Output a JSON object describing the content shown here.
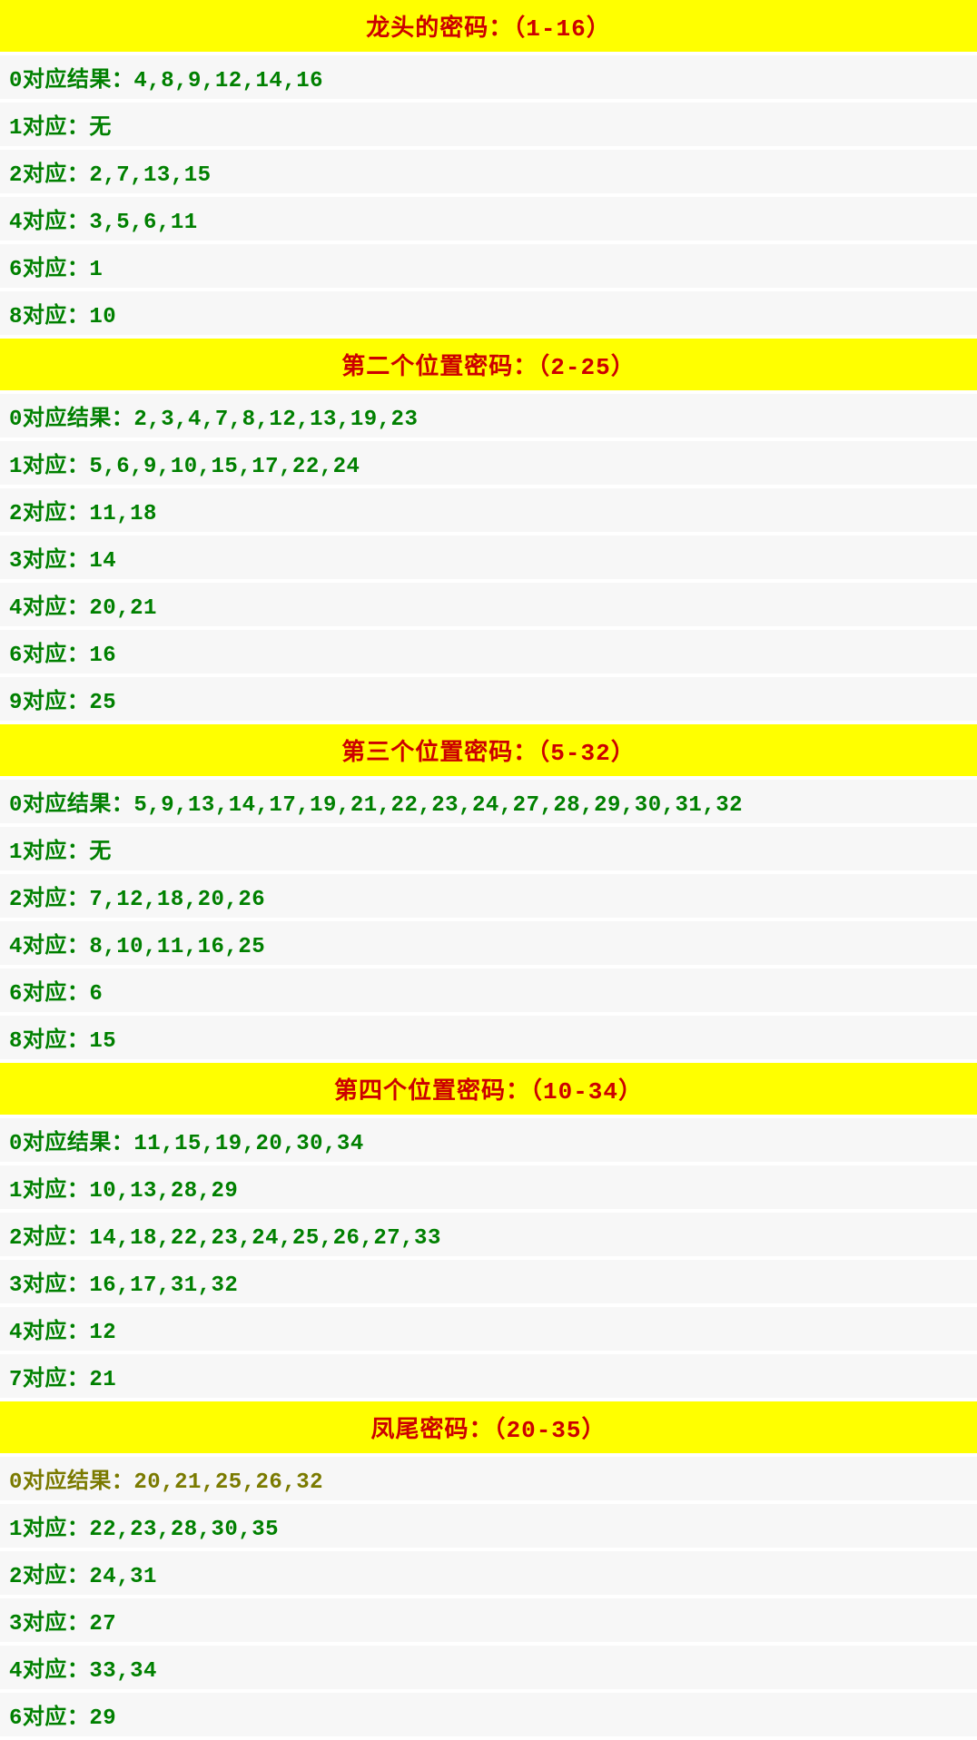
{
  "sections": [
    {
      "title": "龙头的密码：（1-16）",
      "rows": [
        {
          "text": "0对应结果：4,8,9,12,14,16",
          "olive": false
        },
        {
          "text": "1对应：无",
          "olive": false
        },
        {
          "text": "2对应：2,7,13,15",
          "olive": false
        },
        {
          "text": "4对应：3,5,6,11",
          "olive": false
        },
        {
          "text": "6对应：1",
          "olive": false
        },
        {
          "text": "8对应：10",
          "olive": false
        }
      ]
    },
    {
      "title": "第二个位置密码：（2-25）",
      "rows": [
        {
          "text": "0对应结果：2,3,4,7,8,12,13,19,23",
          "olive": false
        },
        {
          "text": "1对应：5,6,9,10,15,17,22,24",
          "olive": false
        },
        {
          "text": "2对应：11,18",
          "olive": false
        },
        {
          "text": "3对应：14",
          "olive": false
        },
        {
          "text": "4对应：20,21",
          "olive": false
        },
        {
          "text": "6对应：16",
          "olive": false
        },
        {
          "text": "9对应：25",
          "olive": false
        }
      ]
    },
    {
      "title": "第三个位置密码：（5-32）",
      "rows": [
        {
          "text": "0对应结果：5,9,13,14,17,19,21,22,23,24,27,28,29,30,31,32",
          "olive": false
        },
        {
          "text": "1对应：无",
          "olive": false
        },
        {
          "text": "2对应：7,12,18,20,26",
          "olive": false
        },
        {
          "text": "4对应：8,10,11,16,25",
          "olive": false
        },
        {
          "text": "6对应：6",
          "olive": false
        },
        {
          "text": "8对应：15",
          "olive": false
        }
      ]
    },
    {
      "title": "第四个位置密码：（10-34）",
      "rows": [
        {
          "text": "0对应结果：11,15,19,20,30,34",
          "olive": false
        },
        {
          "text": "1对应：10,13,28,29",
          "olive": false
        },
        {
          "text": "2对应：14,18,22,23,24,25,26,27,33",
          "olive": false
        },
        {
          "text": "3对应：16,17,31,32",
          "olive": false
        },
        {
          "text": "4对应：12",
          "olive": false
        },
        {
          "text": "7对应：21",
          "olive": false
        }
      ]
    },
    {
      "title": "凤尾密码：（20-35）",
      "rows": [
        {
          "text": "0对应结果：20,21,25,26,32",
          "olive": true
        },
        {
          "text": "1对应：22,23,28,30,35",
          "olive": false
        },
        {
          "text": "2对应：24,31",
          "olive": false
        },
        {
          "text": "3对应：27",
          "olive": false
        },
        {
          "text": "4对应：33,34",
          "olive": false
        },
        {
          "text": "6对应：29",
          "olive": false
        }
      ]
    }
  ],
  "chart_data": {
    "type": "table",
    "title": "位置密码对照表",
    "sections": [
      {
        "name": "龙头的密码",
        "range": "1-16",
        "mappings": [
          {
            "key": 0,
            "values": [
              4,
              8,
              9,
              12,
              14,
              16
            ]
          },
          {
            "key": 1,
            "values": []
          },
          {
            "key": 2,
            "values": [
              2,
              7,
              13,
              15
            ]
          },
          {
            "key": 4,
            "values": [
              3,
              5,
              6,
              11
            ]
          },
          {
            "key": 6,
            "values": [
              1
            ]
          },
          {
            "key": 8,
            "values": [
              10
            ]
          }
        ]
      },
      {
        "name": "第二个位置密码",
        "range": "2-25",
        "mappings": [
          {
            "key": 0,
            "values": [
              2,
              3,
              4,
              7,
              8,
              12,
              13,
              19,
              23
            ]
          },
          {
            "key": 1,
            "values": [
              5,
              6,
              9,
              10,
              15,
              17,
              22,
              24
            ]
          },
          {
            "key": 2,
            "values": [
              11,
              18
            ]
          },
          {
            "key": 3,
            "values": [
              14
            ]
          },
          {
            "key": 4,
            "values": [
              20,
              21
            ]
          },
          {
            "key": 6,
            "values": [
              16
            ]
          },
          {
            "key": 9,
            "values": [
              25
            ]
          }
        ]
      },
      {
        "name": "第三个位置密码",
        "range": "5-32",
        "mappings": [
          {
            "key": 0,
            "values": [
              5,
              9,
              13,
              14,
              17,
              19,
              21,
              22,
              23,
              24,
              27,
              28,
              29,
              30,
              31,
              32
            ]
          },
          {
            "key": 1,
            "values": []
          },
          {
            "key": 2,
            "values": [
              7,
              12,
              18,
              20,
              26
            ]
          },
          {
            "key": 4,
            "values": [
              8,
              10,
              11,
              16,
              25
            ]
          },
          {
            "key": 6,
            "values": [
              6
            ]
          },
          {
            "key": 8,
            "values": [
              15
            ]
          }
        ]
      },
      {
        "name": "第四个位置密码",
        "range": "10-34",
        "mappings": [
          {
            "key": 0,
            "values": [
              11,
              15,
              19,
              20,
              30,
              34
            ]
          },
          {
            "key": 1,
            "values": [
              10,
              13,
              28,
              29
            ]
          },
          {
            "key": 2,
            "values": [
              14,
              18,
              22,
              23,
              24,
              25,
              26,
              27,
              33
            ]
          },
          {
            "key": 3,
            "values": [
              16,
              17,
              31,
              32
            ]
          },
          {
            "key": 4,
            "values": [
              12
            ]
          },
          {
            "key": 7,
            "values": [
              21
            ]
          }
        ]
      },
      {
        "name": "凤尾密码",
        "range": "20-35",
        "mappings": [
          {
            "key": 0,
            "values": [
              20,
              21,
              25,
              26,
              32
            ]
          },
          {
            "key": 1,
            "values": [
              22,
              23,
              28,
              30,
              35
            ]
          },
          {
            "key": 2,
            "values": [
              24,
              31
            ]
          },
          {
            "key": 3,
            "values": [
              27
            ]
          },
          {
            "key": 4,
            "values": [
              33,
              34
            ]
          },
          {
            "key": 6,
            "values": [
              29
            ]
          }
        ]
      }
    ]
  }
}
